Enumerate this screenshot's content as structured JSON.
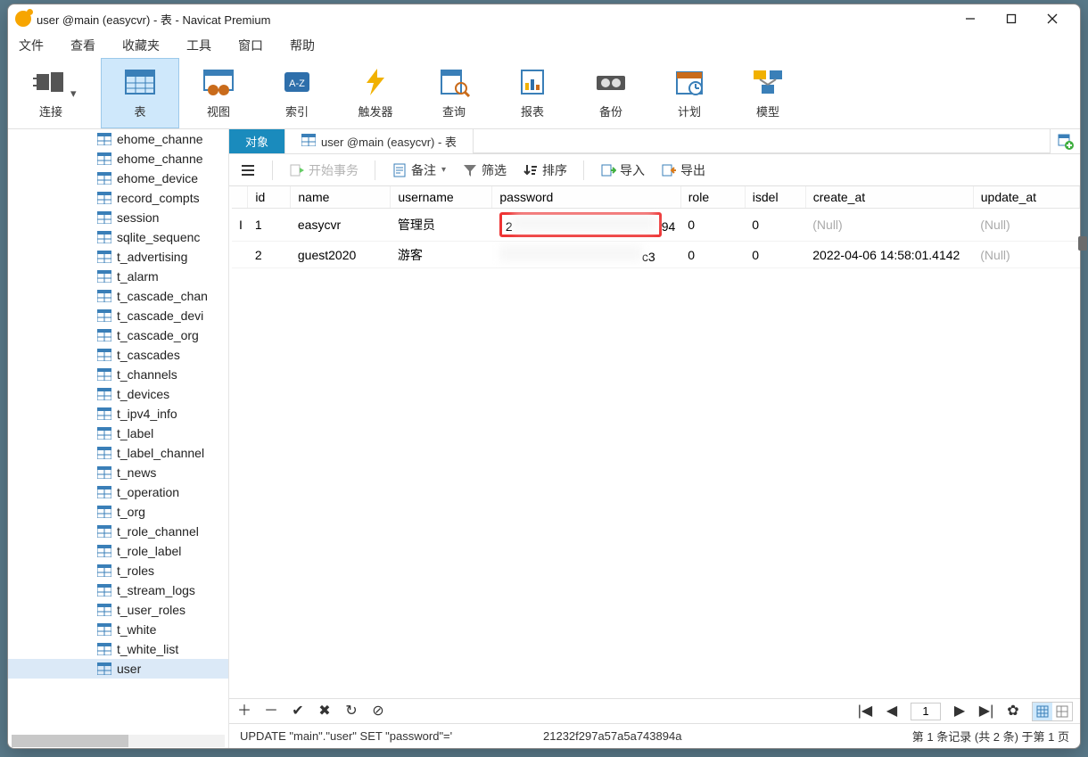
{
  "title": "user @main (easycvr) - 表 - Navicat Premium",
  "menu": [
    "文件",
    "查看",
    "收藏夹",
    "工具",
    "窗口",
    "帮助"
  ],
  "toolbar": [
    {
      "key": "connect",
      "label": "连接"
    },
    {
      "key": "table",
      "label": "表"
    },
    {
      "key": "view",
      "label": "视图"
    },
    {
      "key": "index",
      "label": "索引"
    },
    {
      "key": "trigger",
      "label": "触发器"
    },
    {
      "key": "query",
      "label": "查询"
    },
    {
      "key": "report",
      "label": "报表"
    },
    {
      "key": "backup",
      "label": "备份"
    },
    {
      "key": "schedule",
      "label": "计划"
    },
    {
      "key": "model",
      "label": "模型"
    }
  ],
  "tabs": {
    "objects": "对象",
    "current": "user @main (easycvr) - 表"
  },
  "tb2": {
    "start_tx": "开始事务",
    "remark": "备注",
    "filter": "筛选",
    "sort": "排序",
    "import": "导入",
    "export": "导出"
  },
  "columns": [
    "id",
    "name",
    "username",
    "password",
    "role",
    "isdel",
    "create_at",
    "update_at"
  ],
  "rows": [
    {
      "id": "1",
      "name": "easycvr",
      "username": "管理员",
      "password_prefix": "2",
      "password_trail": "94",
      "role": "0",
      "isdel": "0",
      "create_at": "(Null)",
      "update_at": "(Null)",
      "create_null": true,
      "update_null": true
    },
    {
      "id": "2",
      "name": "guest2020",
      "username": "游客",
      "password_prefix": "",
      "password_trail": "c3",
      "role": "0",
      "isdel": "0",
      "create_at": "2022-04-06 14:58:01.4142",
      "update_at": "(Null)",
      "create_null": false,
      "update_null": true
    }
  ],
  "sidebar": [
    "ehome_channe",
    "ehome_channe",
    "ehome_device",
    "record_compts",
    "session",
    "sqlite_sequenc",
    "t_advertising",
    "t_alarm",
    "t_cascade_chan",
    "t_cascade_devi",
    "t_cascade_org",
    "t_cascades",
    "t_channels",
    "t_devices",
    "t_ipv4_info",
    "t_label",
    "t_label_channel",
    "t_news",
    "t_operation",
    "t_org",
    "t_role_channel",
    "t_role_label",
    "t_roles",
    "t_stream_logs",
    "t_user_roles",
    "t_white",
    "t_white_list",
    "user"
  ],
  "selected_table": "user",
  "pager": {
    "page": "1"
  },
  "status": {
    "sql": "UPDATE \"main\".\"user\" SET \"password\"='",
    "hash": "21232f297a57a5a743894a",
    "info": "第 1 条记录 (共 2 条) 于第 1 页"
  }
}
